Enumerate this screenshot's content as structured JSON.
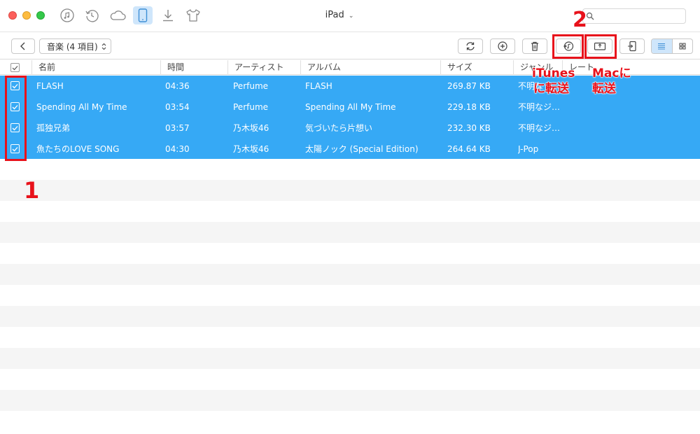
{
  "window": {
    "device_title": "iPad",
    "search": {
      "placeholder": ""
    }
  },
  "topbar": {
    "icons": [
      "music-icon",
      "history-icon",
      "cloud-icon",
      "ipad-icon",
      "download-icon",
      "tshirt-icon"
    ],
    "active_icon": "ipad-icon"
  },
  "toolbar": {
    "category_label": "音楽 (4 項目)",
    "buttons": [
      "back-icon",
      "refresh-icon",
      "add-icon",
      "trash-icon",
      "to-itunes-icon",
      "to-mac-icon",
      "to-device-icon"
    ],
    "view_mode": "list"
  },
  "table": {
    "columns": [
      "名前",
      "時間",
      "アーティスト",
      "アルバム",
      "サイズ",
      "ジャンル",
      "レート"
    ],
    "rows": [
      {
        "name": "FLASH",
        "time": "04:36",
        "artist": "Perfume",
        "album": "FLASH",
        "size": "269.87 KB",
        "genre": "不明な",
        "checked": true
      },
      {
        "name": "Spending All My Time",
        "time": "03:54",
        "artist": "Perfume",
        "album": "Spending All My Time",
        "size": "229.18 KB",
        "genre": "不明なジ…",
        "checked": true
      },
      {
        "name": "孤独兄弟",
        "time": "03:57",
        "artist": "乃木坂46",
        "album": "気づいたら片想い",
        "size": "232.30 KB",
        "genre": "不明なジ…",
        "checked": true
      },
      {
        "name": "魚たちのLOVE SONG",
        "time": "04:30",
        "artist": "乃木坂46",
        "album": "太陽ノック (Special Edition)",
        "size": "264.64 KB",
        "genre": "J-Pop",
        "checked": true
      }
    ]
  },
  "annotations": {
    "step1": "1",
    "step2": "2",
    "itunes_label_line1": "iTunes",
    "itunes_label_line2": "に転送",
    "mac_label_line1": "Macに",
    "mac_label_line2": "転送",
    "color": "#e8121b"
  },
  "colors": {
    "selection": "#36a9f5",
    "active_tab": "#cfe6fb",
    "stripe": "#f5f5f5"
  }
}
